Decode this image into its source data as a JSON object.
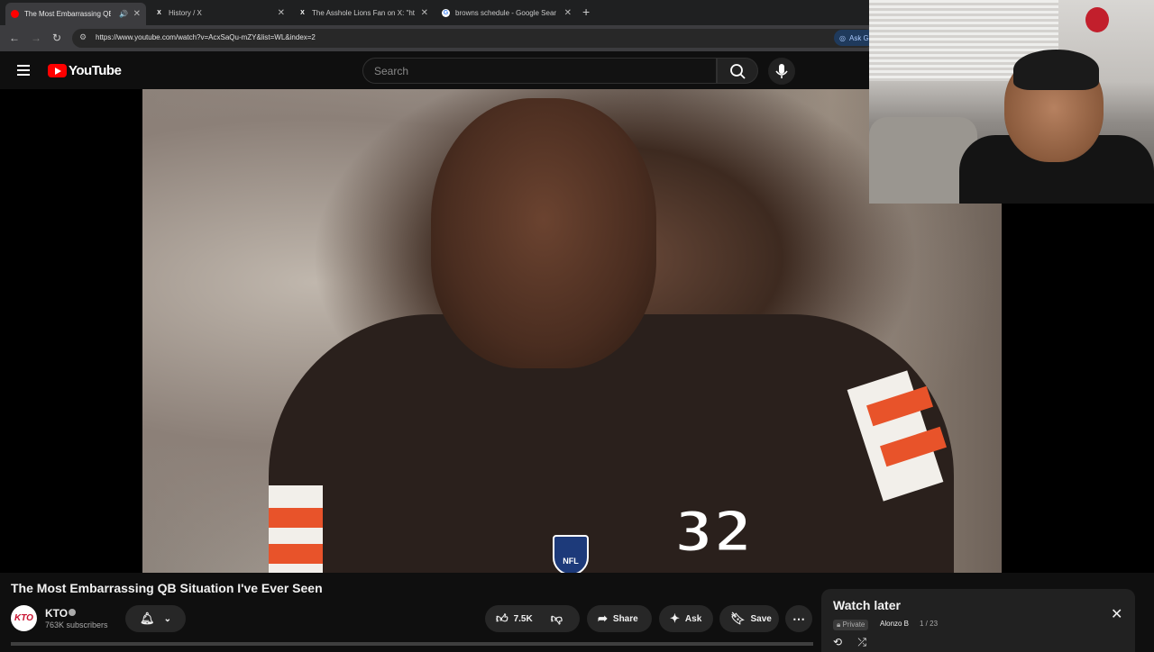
{
  "browser": {
    "tabs": [
      {
        "title": "The Most Embarrassing QB",
        "favicon": "youtube-favicon",
        "active": true
      },
      {
        "title": "History / X",
        "favicon": "x-favicon",
        "active": false
      },
      {
        "title": "The Asshole Lions Fan on X: \"ht",
        "favicon": "x-favicon",
        "active": false
      },
      {
        "title": "browns schedule - Google Sear",
        "favicon": "google-favicon",
        "active": false
      }
    ],
    "url": "https://www.youtube.com/watch?v=AcxSaQu-mZY&list=WL&index=2",
    "ask_label": "Ask G"
  },
  "youtube": {
    "logo_text": "YouTube",
    "search_placeholder": "Search"
  },
  "video": {
    "title": "The Most Embarrassing QB Situation I've Ever Seen",
    "jersey_number": "32",
    "nfl_logo_text": "NFL"
  },
  "channel": {
    "avatar_text": "KTO",
    "name": "KTO",
    "subscribers": "763K subscribers"
  },
  "actions": {
    "likes": "7.5K",
    "share": "Share",
    "ask": "Ask",
    "save": "Save"
  },
  "playlist": {
    "title": "Watch later",
    "privacy": "Private",
    "owner": "Alonzo B",
    "position": "1 / 23"
  },
  "colors": {
    "youtube_red": "#ff0000",
    "browns_orange": "#e8532a",
    "browns_brown": "#2a201c"
  }
}
